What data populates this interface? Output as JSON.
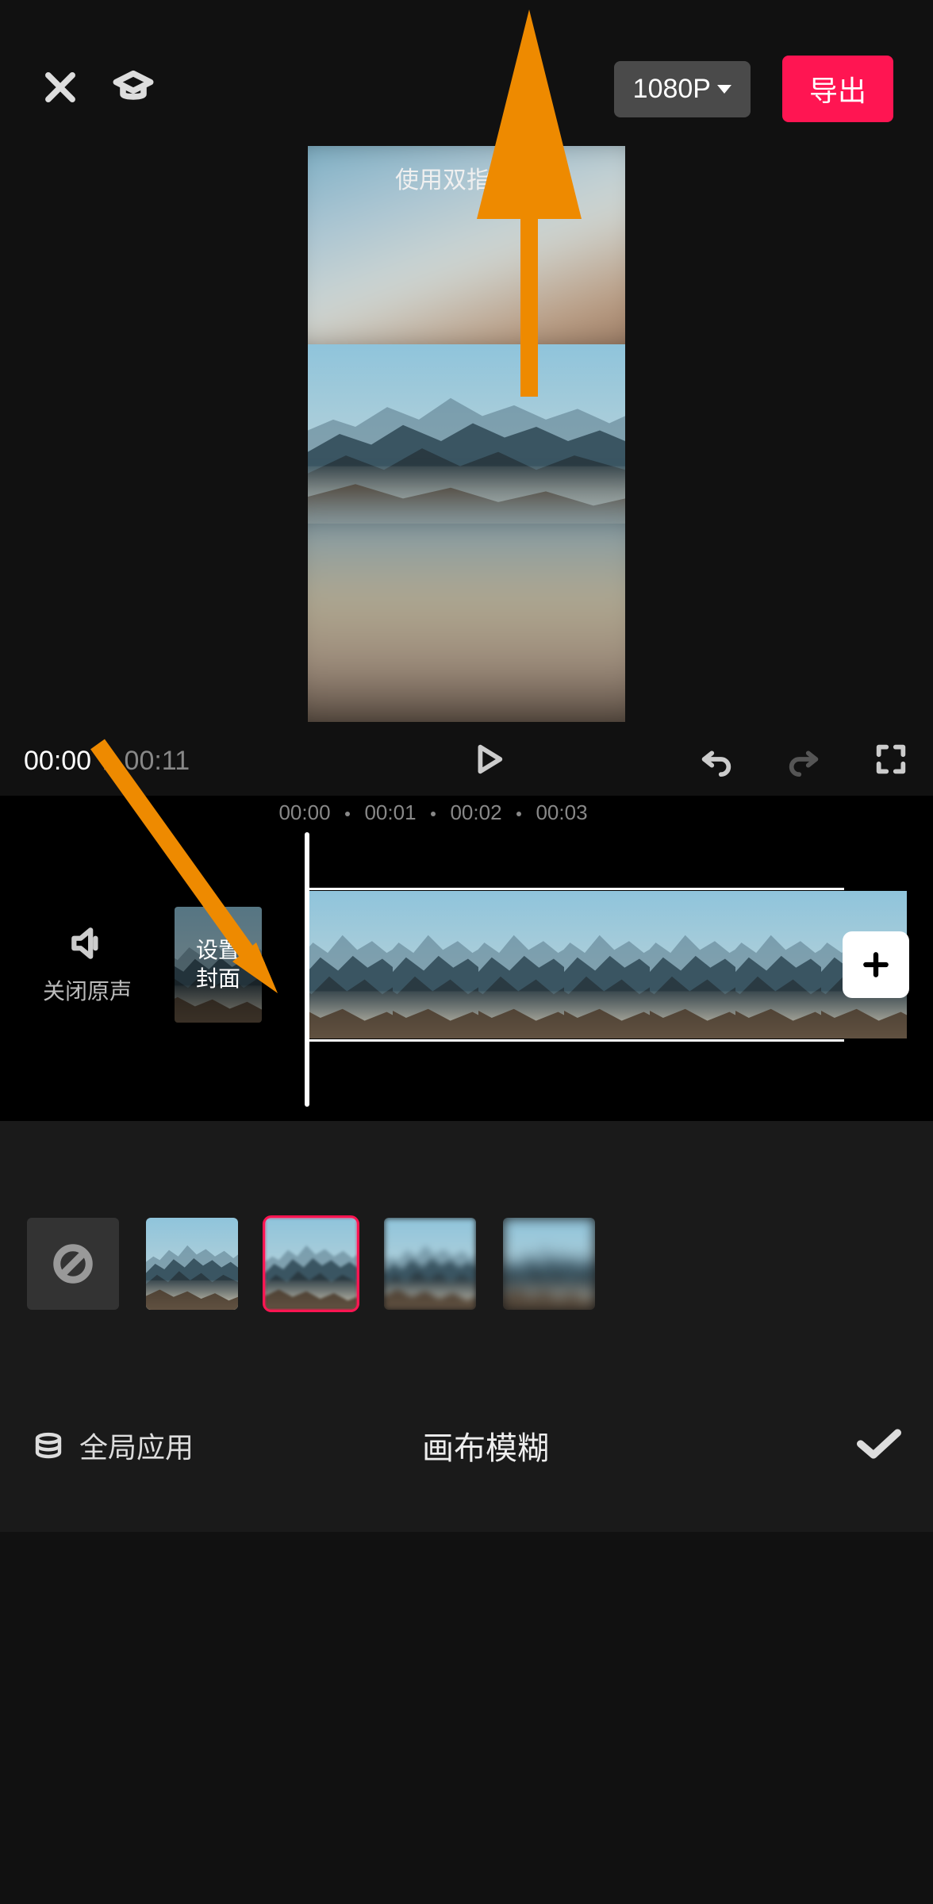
{
  "header": {
    "resolution_label": "1080P",
    "export_label": "导出"
  },
  "preview": {
    "hint_text": "使用双指缩放"
  },
  "playback": {
    "current_time": "00:00",
    "total_time": "00:11"
  },
  "timeline": {
    "ruler": [
      "00:00",
      "00:01",
      "00:02",
      "00:03"
    ],
    "mute_label": "关闭原声",
    "cover_label_line1": "设置",
    "cover_label_line2": "封面"
  },
  "blur_panel": {
    "title": "画布模糊",
    "global_apply_label": "全局应用",
    "selected_index": 2
  },
  "icons": {
    "close": "close-icon",
    "tutorial": "graduation-cap-icon",
    "play": "play-icon",
    "undo": "undo-icon",
    "redo": "redo-icon",
    "fullscreen": "fullscreen-icon",
    "speaker": "speaker-icon",
    "add": "plus-icon",
    "none": "no-sign-icon",
    "stack": "stack-icon",
    "confirm": "check-icon"
  },
  "colors": {
    "accent": "#ff1552",
    "annotation": "#ee8a00"
  }
}
